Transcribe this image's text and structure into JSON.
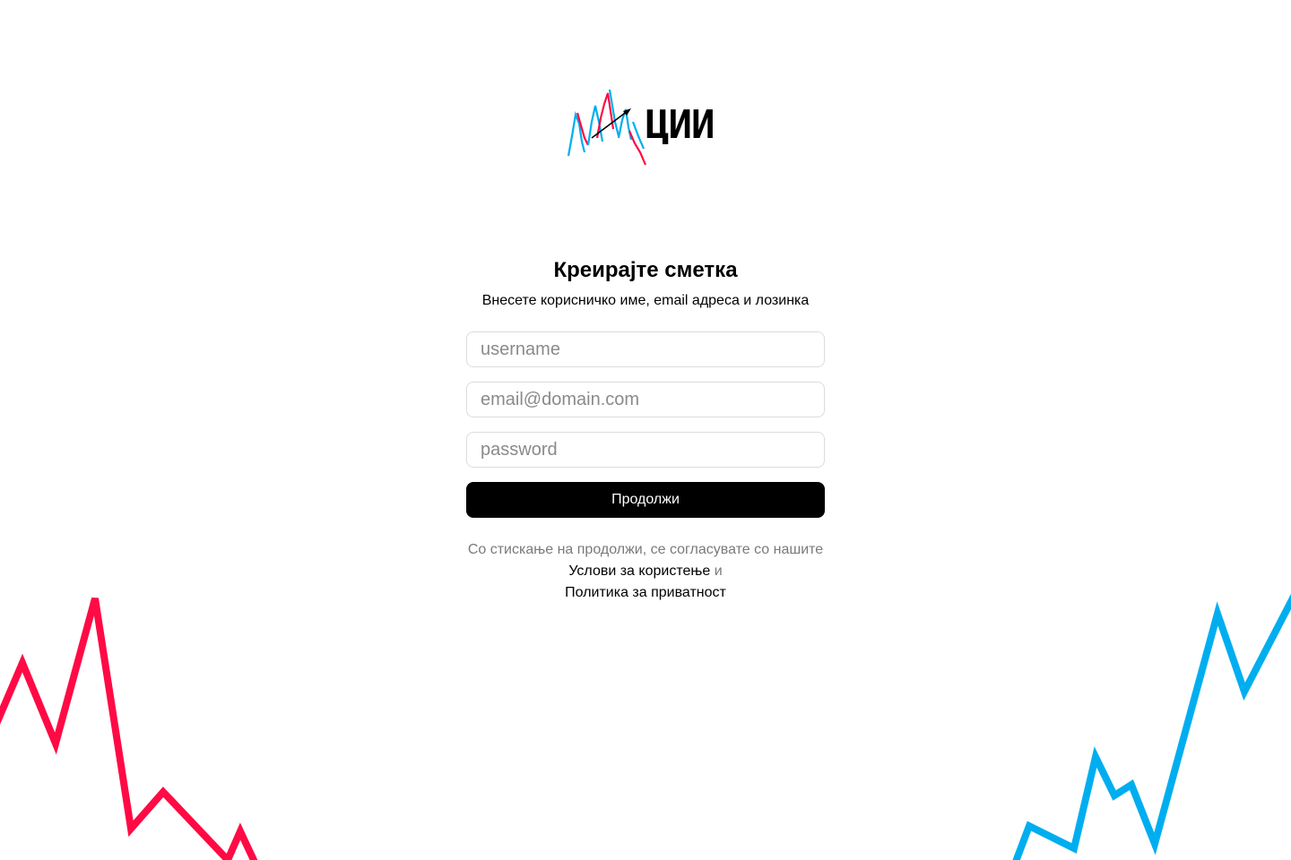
{
  "brand": {
    "logo_text": "ЦИИ",
    "icon": "candlestick-chart-logo-icon",
    "colors": {
      "red": "#ff0a45",
      "blue": "#00aeef",
      "ink": "#000000"
    }
  },
  "form": {
    "title": "Креирајте сметка",
    "subtitle": "Внесете корисничко име, email адреса и лозинка",
    "username_placeholder": "username",
    "email_placeholder": "email@domain.com",
    "password_placeholder": "password",
    "submit_label": "Продолжи"
  },
  "legal": {
    "prefix": "Со стискање на продолжи, се согласувате со нашите",
    "terms_link": "Услови за користење",
    "conjunction": "и",
    "privacy_link": "Политика за приватност"
  },
  "decorations": {
    "left_line_color": "#ff0a45",
    "right_line_color": "#00aeef",
    "icon_left": "falling-line-icon",
    "icon_right": "rising-line-icon"
  }
}
